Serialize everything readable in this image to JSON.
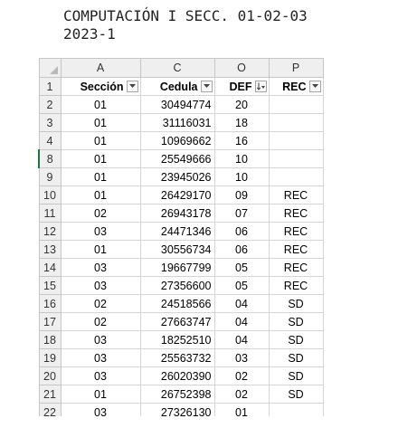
{
  "title": {
    "line1": "COMPUTACIÓN I SECC. 01-02-03",
    "line2": "2023-1"
  },
  "columns": [
    {
      "letter": "A",
      "header": "Sección",
      "filter": "filter-dropdown"
    },
    {
      "letter": "C",
      "header": "Cedula",
      "filter": "filter-dropdown"
    },
    {
      "letter": "O",
      "header": "DEF",
      "filter": "sort-descending"
    },
    {
      "letter": "P",
      "header": "REC",
      "filter": "filter-dropdown"
    }
  ],
  "header_row_number": "1",
  "rows": [
    {
      "num": "2",
      "seccion": "01",
      "cedula": "30494774",
      "def": "20",
      "rec": ""
    },
    {
      "num": "3",
      "seccion": "01",
      "cedula": "31116031",
      "def": "18",
      "rec": ""
    },
    {
      "num": "4",
      "seccion": "01",
      "cedula": "10969662",
      "def": "16",
      "rec": ""
    },
    {
      "num": "8",
      "seccion": "01",
      "cedula": "25549666",
      "def": "10",
      "rec": ""
    },
    {
      "num": "9",
      "seccion": "01",
      "cedula": "23945026",
      "def": "10",
      "rec": ""
    },
    {
      "num": "10",
      "seccion": "01",
      "cedula": "26429170",
      "def": "09",
      "rec": "REC"
    },
    {
      "num": "11",
      "seccion": "02",
      "cedula": "26943178",
      "def": "07",
      "rec": "REC"
    },
    {
      "num": "12",
      "seccion": "03",
      "cedula": "24471346",
      "def": "06",
      "rec": "REC"
    },
    {
      "num": "13",
      "seccion": "01",
      "cedula": "30556734",
      "def": "06",
      "rec": "REC"
    },
    {
      "num": "14",
      "seccion": "03",
      "cedula": "19667799",
      "def": "05",
      "rec": "REC"
    },
    {
      "num": "15",
      "seccion": "03",
      "cedula": "27356600",
      "def": "05",
      "rec": "REC"
    },
    {
      "num": "16",
      "seccion": "02",
      "cedula": "24518566",
      "def": "04",
      "rec": "SD"
    },
    {
      "num": "17",
      "seccion": "02",
      "cedula": "27663747",
      "def": "04",
      "rec": "SD"
    },
    {
      "num": "18",
      "seccion": "03",
      "cedula": "18252510",
      "def": "04",
      "rec": "SD"
    },
    {
      "num": "19",
      "seccion": "03",
      "cedula": "25563732",
      "def": "03",
      "rec": "SD"
    },
    {
      "num": "20",
      "seccion": "03",
      "cedula": "26020390",
      "def": "02",
      "rec": "SD"
    },
    {
      "num": "21",
      "seccion": "01",
      "cedula": "26752398",
      "def": "02",
      "rec": "SD"
    },
    {
      "num": "22",
      "seccion": "03",
      "cedula": "27326130",
      "def": "01",
      "rec": ""
    }
  ],
  "selected_row_num": "8"
}
